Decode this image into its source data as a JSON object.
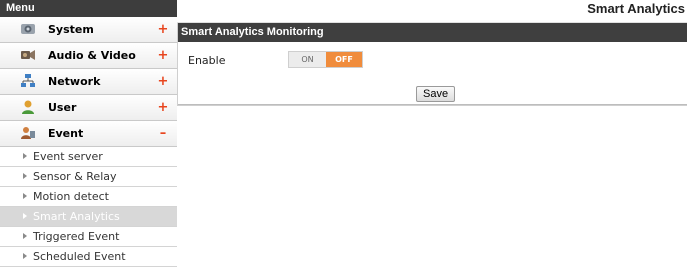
{
  "sidebar": {
    "header": "Menu",
    "items": [
      {
        "label": "System",
        "toggle": "+",
        "icon": "system-icon"
      },
      {
        "label": "Audio & Video",
        "toggle": "+",
        "icon": "audio-video-icon"
      },
      {
        "label": "Network",
        "toggle": "+",
        "icon": "network-icon"
      },
      {
        "label": "User",
        "toggle": "+",
        "icon": "user-icon"
      },
      {
        "label": "Event",
        "toggle": "–",
        "icon": "event-icon"
      }
    ],
    "subitems": [
      "Event server",
      "Sensor & Relay",
      "Motion detect",
      "Smart Analytics",
      "Triggered Event",
      "Scheduled Event"
    ],
    "active_subitem": "Smart Analytics"
  },
  "main": {
    "title": "Smart Analytics",
    "panel_title": "Smart Analytics Monitoring",
    "enable_label": "Enable",
    "toggle_on": "ON",
    "toggle_off": "OFF",
    "toggle_state": "OFF",
    "save_label": "Save"
  },
  "colors": {
    "header_bg": "#3d3d3d",
    "accent_orange": "#f08c3c",
    "toggle_sign": "#e8451e"
  }
}
